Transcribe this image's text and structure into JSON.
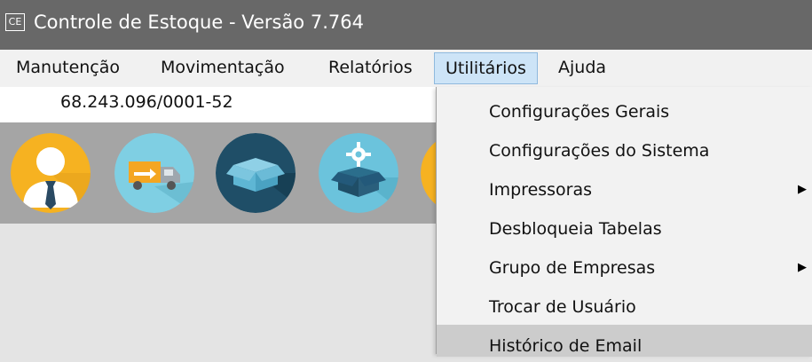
{
  "window": {
    "icon_text": "CE",
    "title": "Controle de Estoque - Versão 7.764"
  },
  "menubar": {
    "items": [
      {
        "label": "Manutenção"
      },
      {
        "label": "Movimentação"
      },
      {
        "label": "Relatórios"
      },
      {
        "label": "Utilitários",
        "active": true
      },
      {
        "label": "Ajuda"
      }
    ]
  },
  "company": {
    "cnpj": "68.243.096/0001-52"
  },
  "toolbar": {
    "icons": [
      "user-icon",
      "delivery-truck-icon",
      "box-icon",
      "box-settings-icon",
      "partial-icon"
    ]
  },
  "dropdown": {
    "items": [
      {
        "label": "Configurações Gerais"
      },
      {
        "label": "Configurações do Sistema"
      },
      {
        "label": "Impressoras",
        "submenu": true
      },
      {
        "label": "Desbloqueia Tabelas"
      },
      {
        "label": "Grupo de Empresas",
        "submenu": true
      },
      {
        "label": "Trocar de Usuário"
      },
      {
        "label": "Histórico de Email",
        "highlighted": true
      }
    ],
    "submenu_arrow": "▶"
  },
  "colors": {
    "titlebar": "#686868",
    "menubar": "#f1f1f1",
    "menu_active": "#cde4f7",
    "toolbar": "#a5a5a5",
    "user_bg": "#f6b221",
    "truck_bg": "#7fcfe3",
    "box_bg": "#1f4e67",
    "box_settings_bg": "#6bc3dc"
  }
}
